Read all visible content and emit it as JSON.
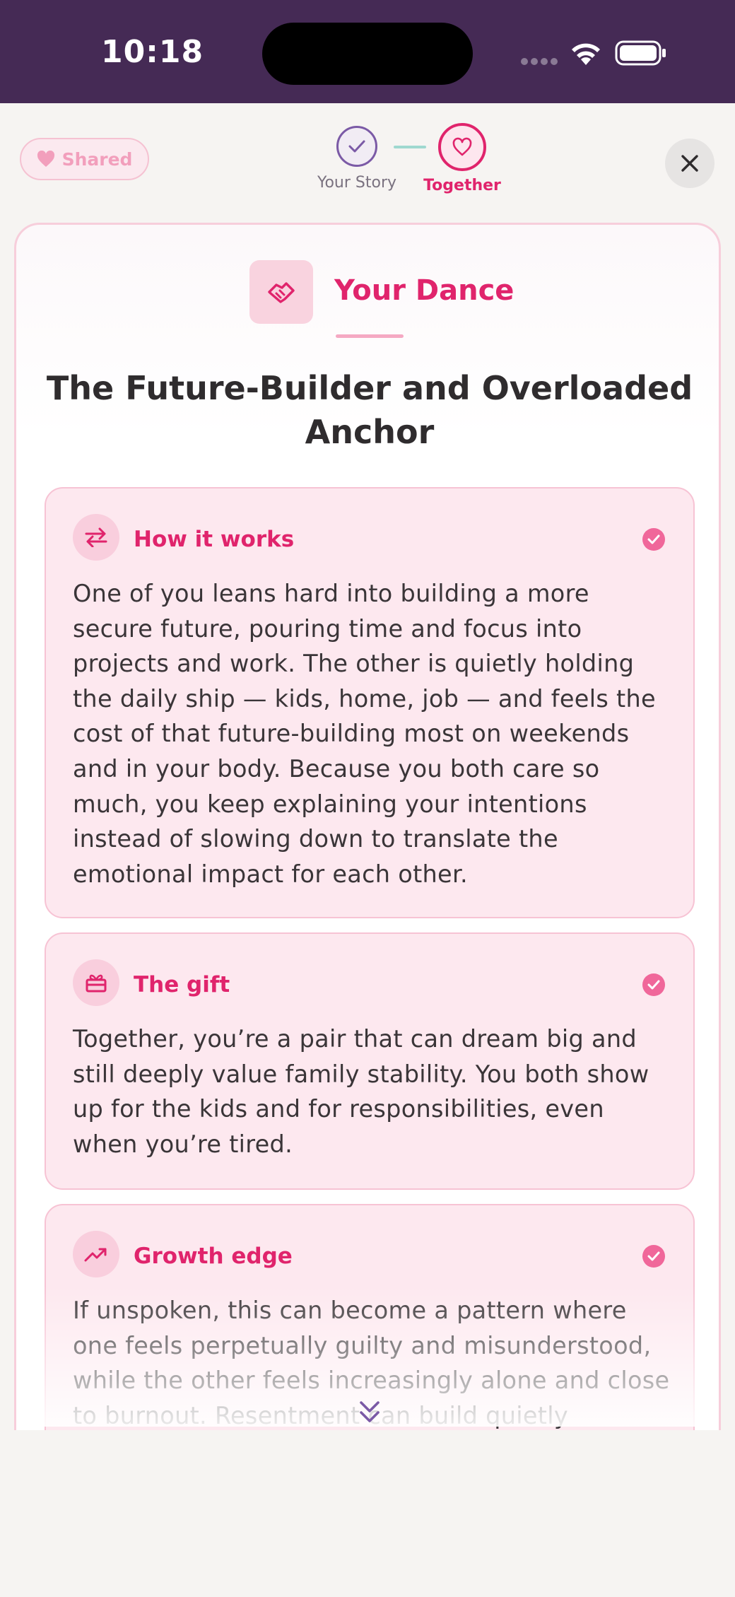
{
  "status_bar": {
    "time": "10:18"
  },
  "top_bar": {
    "shared_label": "Shared",
    "steps": [
      {
        "label": "Your Story",
        "state": "completed"
      },
      {
        "label": "Together",
        "state": "active"
      }
    ]
  },
  "card": {
    "header_label": "Your Dance",
    "title": "The Future-Builder and Overloaded Anchor",
    "sections": [
      {
        "title": "How it works",
        "icon": "swap-arrows-icon",
        "body": "One of you leans hard into building a more secure future, pouring time and focus into projects and work. The other is quietly holding the daily ship — kids, home, job — and feels the cost of that future-building most on weekends and in your body. Because you both care so much, you keep explaining your intentions instead of slowing down to translate the emotional impact for each other."
      },
      {
        "title": "The gift",
        "icon": "gift-icon",
        "body": "Together, you’re a pair that can dream big and still deeply value family stability. You both show up for the kids and for responsibilities, even when you’re tired."
      },
      {
        "title": "Growth edge",
        "icon": "trending-up-icon",
        "body": "If unspoken, this can become a pattern where one feels perpetually guilty and misunderstood, while the other feels increasingly alone and close to burnout. Resentment can build quietly"
      }
    ]
  },
  "colors": {
    "status_bar": "#452a55",
    "accent": "#e0246c",
    "section_bg": "#fde8ef",
    "purple": "#7b5aa6",
    "teal": "#9fd8d0"
  }
}
